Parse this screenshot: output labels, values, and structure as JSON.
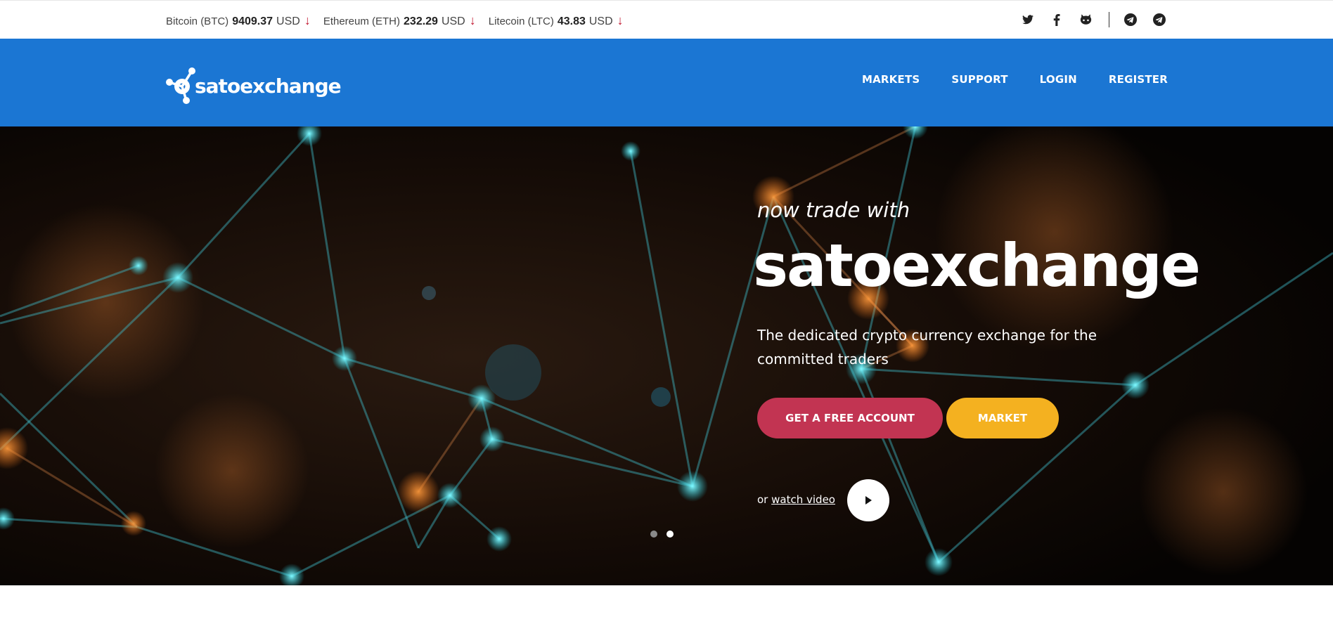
{
  "ticker": [
    {
      "name": "Bitcoin (BTC)",
      "price": "9409.37",
      "unit": "USD",
      "arrow": "↓"
    },
    {
      "name": "Ethereum (ETH)",
      "price": "232.29",
      "unit": "USD",
      "arrow": "↓"
    },
    {
      "name": "Litecoin (LTC)",
      "price": "43.83",
      "unit": "USD",
      "arrow": "↓"
    }
  ],
  "socials": [
    "twitter-icon",
    "facebook-icon",
    "github-icon",
    "telegram-icon",
    "telegram-icon"
  ],
  "colors": {
    "header_blue": "#1b76d3",
    "account_button": "#c23452",
    "market_button": "#f4b120",
    "price_down": "#c0132c"
  },
  "header": {
    "logo_text": "satoexchange",
    "nav": [
      "MARKETS",
      "SUPPORT",
      "LOGIN",
      "REGISTER"
    ]
  },
  "hero": {
    "kicker": "now trade with",
    "title": "satoexchange",
    "subtitle": "The dedicated crypto currency exchange for the committed traders",
    "primary_button": "GET A FREE ACCOUNT",
    "secondary_button": "MARKET",
    "watch_prefix": "or",
    "watch_link": "watch video",
    "slides_total": 2,
    "slides_active": 2
  }
}
